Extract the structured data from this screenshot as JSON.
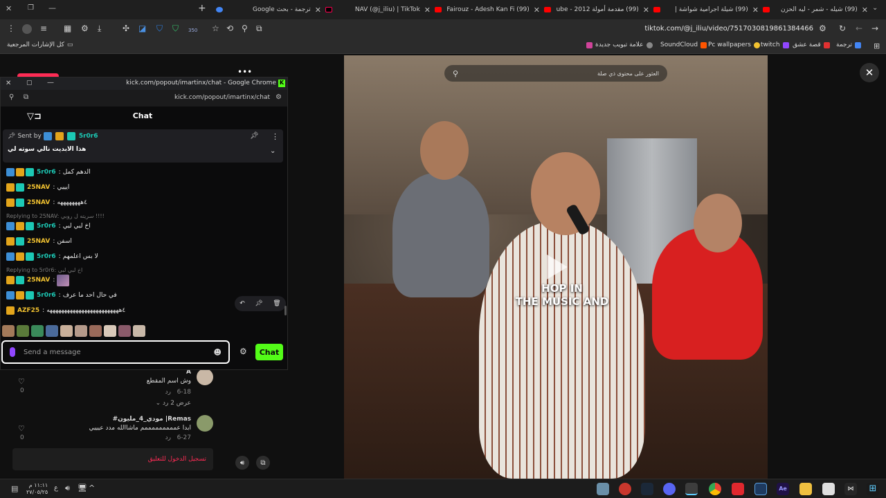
{
  "tabs": [
    {
      "title": "ترجمة - بحث Google",
      "color": "#4285f4"
    },
    {
      "title": "NAV (@j_iliu) | TikTok",
      "color": "#111111",
      "active": true
    },
    {
      "title": "(99) Fairouz - Adesh Kan Fi",
      "color": "#ff0000"
    },
    {
      "title": "(99) مقدمة أمولة 2012 - ube",
      "color": "#ff0000"
    },
    {
      "title": "(99) شيلة اجرامية شواشة |",
      "color": "#ff0000"
    },
    {
      "title": "(99) شيله - شمر - ليه الحزن",
      "color": "#ff0000"
    }
  ],
  "toolbar": {
    "url": "tiktok.com/@j_iliu/video/7517030819861384466",
    "extension_badge": "350"
  },
  "bookmarks": {
    "all_bookmarks": "كل الإشارات المرجعية",
    "items": [
      {
        "label": "ترجمة",
        "color": "#4285f4"
      },
      {
        "label": "قصة عشق",
        "color": "#e03131"
      },
      {
        "label": "twitch",
        "color": "#9146ff"
      },
      {
        "label": "Pc wallpapers",
        "color": "#f2c230"
      },
      {
        "label": "SoundCloud",
        "color": "#ff5500"
      },
      {
        "label": "علامة تبويب جديدة",
        "color": "#d0439a"
      }
    ]
  },
  "popup": {
    "window_title": "kick.com/popout/imartinx/chat - Google Chrome",
    "url": "kick.com/popout/imartinx/chat",
    "chat_title": "Chat",
    "pinned": {
      "sent_by_label": "Sent by",
      "user": "5r0r6",
      "text": "هذا الابديت نالي سوته لي"
    },
    "messages": [
      {
        "type": "msg",
        "user": "5r0r6",
        "text": "الدهم كمل",
        "color": "#1cc9b5",
        "badges": [
          "blue",
          "gold",
          "teal"
        ]
      },
      {
        "type": "msg",
        "user": "25NAV",
        "text": "ايييي",
        "color": "#f2c230",
        "badges": [
          "gold",
          "teal"
        ]
      },
      {
        "type": "msg",
        "user": "25NAV",
        "text": "٤ههههههههه",
        "color": "#f2c230",
        "badges": [
          "gold",
          "teal"
        ]
      },
      {
        "type": "reply",
        "text": "Replying to 25NAV: سريته ل روبي !!!!"
      },
      {
        "type": "msg",
        "user": "5r0r6",
        "text": "اخ لبي لبي",
        "color": "#1cc9b5",
        "badges": [
          "blue",
          "gold",
          "teal"
        ]
      },
      {
        "type": "msg",
        "user": "25NAV",
        "text": "اسفن",
        "color": "#f2c230",
        "badges": [
          "gold",
          "teal"
        ]
      },
      {
        "type": "msg",
        "user": "5r0r6",
        "text": "لا بس اعلمهم",
        "color": "#1cc9b5",
        "badges": [
          "blue",
          "gold",
          "teal"
        ]
      },
      {
        "type": "reply",
        "text": "Replying to 5r0r6: اخ لبي لبي"
      },
      {
        "type": "msg",
        "user": "25NAV",
        "text": "",
        "color": "#f2c230",
        "badges": [
          "gold",
          "teal"
        ],
        "emote": true
      },
      {
        "type": "msg",
        "user": "5r0r6",
        "text": "في حال احد ما عرف",
        "color": "#1cc9b5",
        "badges": [
          "blue",
          "gold",
          "teal"
        ]
      },
      {
        "type": "msg",
        "user": "AZF25",
        "text": "٤هههههههههههههههههههههههههه",
        "color": "#f2c230",
        "badges": [
          "gold"
        ]
      }
    ],
    "input_placeholder": "Send a message",
    "chat_button": "Chat"
  },
  "video": {
    "search_placeholder": "العثور على محتوى ذي صلة",
    "caption_line1": "HOP IN",
    "caption_line2": "THE MUSIC AND"
  },
  "comments": [
    {
      "user": "A",
      "text": "وش اسم المقطع",
      "date": "6-18",
      "reply_label": "رد",
      "view_replies": "عرض 2 رد",
      "likes": "0"
    },
    {
      "user": "Remas| مودي_4_مليون#",
      "text": "ابدا عمممممممممم ماشاالله مدد عيييي",
      "date": "6-27",
      "reply_label": "رد",
      "likes": "0"
    }
  ],
  "login_to_comment": "تسجيل الدخول للتعليق",
  "taskbar": {
    "time": "١١:١١ م",
    "date": "٢٧/٠٥/٢٥",
    "lang": "ع"
  },
  "colors": {
    "kick_green": "#53fc18",
    "login_red": "#fe2c55",
    "accent_blue": "#3d8fd6"
  }
}
